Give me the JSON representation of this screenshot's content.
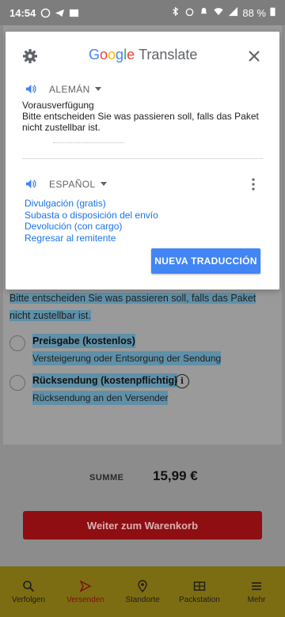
{
  "status_bar": {
    "time": "14:54",
    "battery": "88 %"
  },
  "background_app": {
    "question_text": "Bitte entscheiden Sie was passieren soll, falls das Paket nicht zustellbar ist.",
    "options": [
      {
        "title": "Preisgabe (kostenlos)",
        "subtitle": "Versteigerung oder Entsorgung der Sendung"
      },
      {
        "title": "Rücksendung (kostenpflichtig)",
        "subtitle": "Rücksendung an den Versender"
      }
    ],
    "sum_label": "SUMME",
    "sum_value": "15,99 €",
    "cart_button": "Weiter zum Warenkorb",
    "nav": [
      {
        "label": "Verfolgen",
        "icon": "search-icon"
      },
      {
        "label": "Versenden",
        "icon": "send-icon"
      },
      {
        "label": "Standorte",
        "icon": "location-pin-icon"
      },
      {
        "label": "Packstation",
        "icon": "packstation-icon"
      },
      {
        "label": "Mehr",
        "icon": "menu-icon"
      }
    ]
  },
  "translate_popup": {
    "brand_letters": [
      "G",
      "o",
      "o",
      "g",
      "l",
      "e"
    ],
    "brand_word": "Translate",
    "source_language": "ALEMÁN",
    "source_text_line1": "Vorausverfügung",
    "source_text_line2": "Bitte entscheiden Sie was passieren soll, falls das Paket nicht zustellbar ist.",
    "target_language": "ESPAÑOL",
    "translations": [
      "Divulgación (gratis)",
      "Subasta o disposición del envío",
      "Devolución (con cargo)",
      "Regresar al remitente"
    ],
    "new_translation_button": "NUEVA TRADUCCIÓN",
    "colors": {
      "accent": "#4285f4",
      "link": "#1a73e8"
    }
  }
}
